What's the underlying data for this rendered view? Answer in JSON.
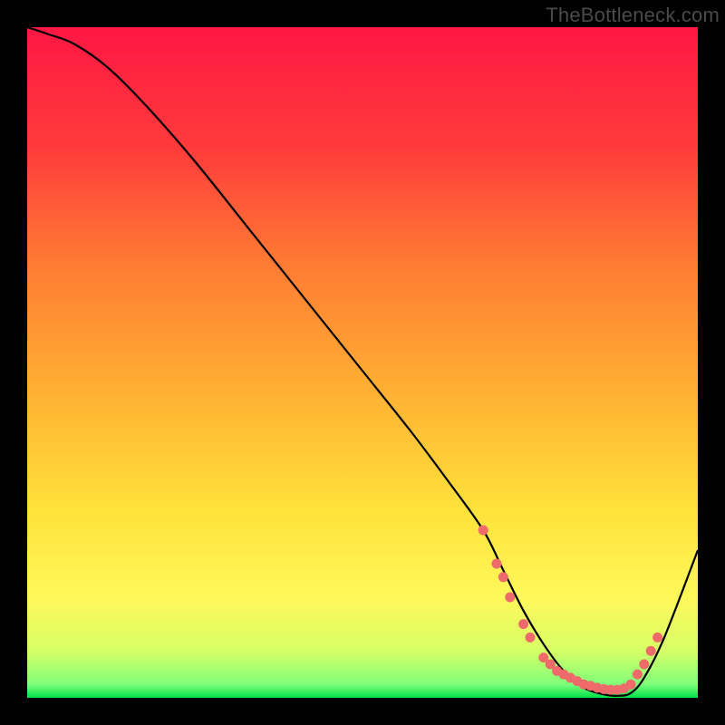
{
  "watermark": "TheBottleneck.com",
  "colors": {
    "gradient_stops": [
      "#ff1744",
      "#ff3b3b",
      "#ff7a33",
      "#ffb233",
      "#ffe23a",
      "#fff85a",
      "#d6ff66",
      "#7fff7a",
      "#00e24a"
    ],
    "curve_stroke": "#000000",
    "dot_fill": "#ef6a6a",
    "dot_stroke": "#ef6a6a"
  },
  "chart_data": {
    "type": "line",
    "title": "",
    "xlabel": "",
    "ylabel": "",
    "x_range": [
      0,
      100
    ],
    "y_range": [
      0,
      100
    ],
    "series": [
      {
        "name": "bottleneck_curve",
        "x": [
          0,
          3,
          7,
          12,
          18,
          25,
          33,
          41,
          49,
          57,
          63,
          68,
          71,
          74,
          77,
          80,
          83,
          86,
          88,
          90,
          92,
          95,
          100
        ],
        "y": [
          100,
          99,
          97.5,
          94,
          88,
          80,
          70,
          60,
          50,
          40,
          32,
          25,
          19,
          13,
          8,
          4,
          1.5,
          0.5,
          0.3,
          0.7,
          3,
          9,
          22
        ]
      }
    ],
    "dots": [
      {
        "x": 68,
        "y": 25
      },
      {
        "x": 70,
        "y": 20
      },
      {
        "x": 71,
        "y": 18
      },
      {
        "x": 72,
        "y": 15
      },
      {
        "x": 74,
        "y": 11
      },
      {
        "x": 75,
        "y": 9
      },
      {
        "x": 77,
        "y": 6
      },
      {
        "x": 78,
        "y": 5
      },
      {
        "x": 79,
        "y": 4
      },
      {
        "x": 80,
        "y": 3.5
      },
      {
        "x": 81,
        "y": 3
      },
      {
        "x": 82,
        "y": 2.5
      },
      {
        "x": 83,
        "y": 2
      },
      {
        "x": 84,
        "y": 1.8
      },
      {
        "x": 85,
        "y": 1.5
      },
      {
        "x": 86,
        "y": 1.3
      },
      {
        "x": 87,
        "y": 1.2
      },
      {
        "x": 88,
        "y": 1.2
      },
      {
        "x": 89,
        "y": 1.4
      },
      {
        "x": 90,
        "y": 2
      },
      {
        "x": 91,
        "y": 3.5
      },
      {
        "x": 92,
        "y": 5
      },
      {
        "x": 93,
        "y": 7
      },
      {
        "x": 94,
        "y": 9
      }
    ],
    "dot_radius": 5
  }
}
